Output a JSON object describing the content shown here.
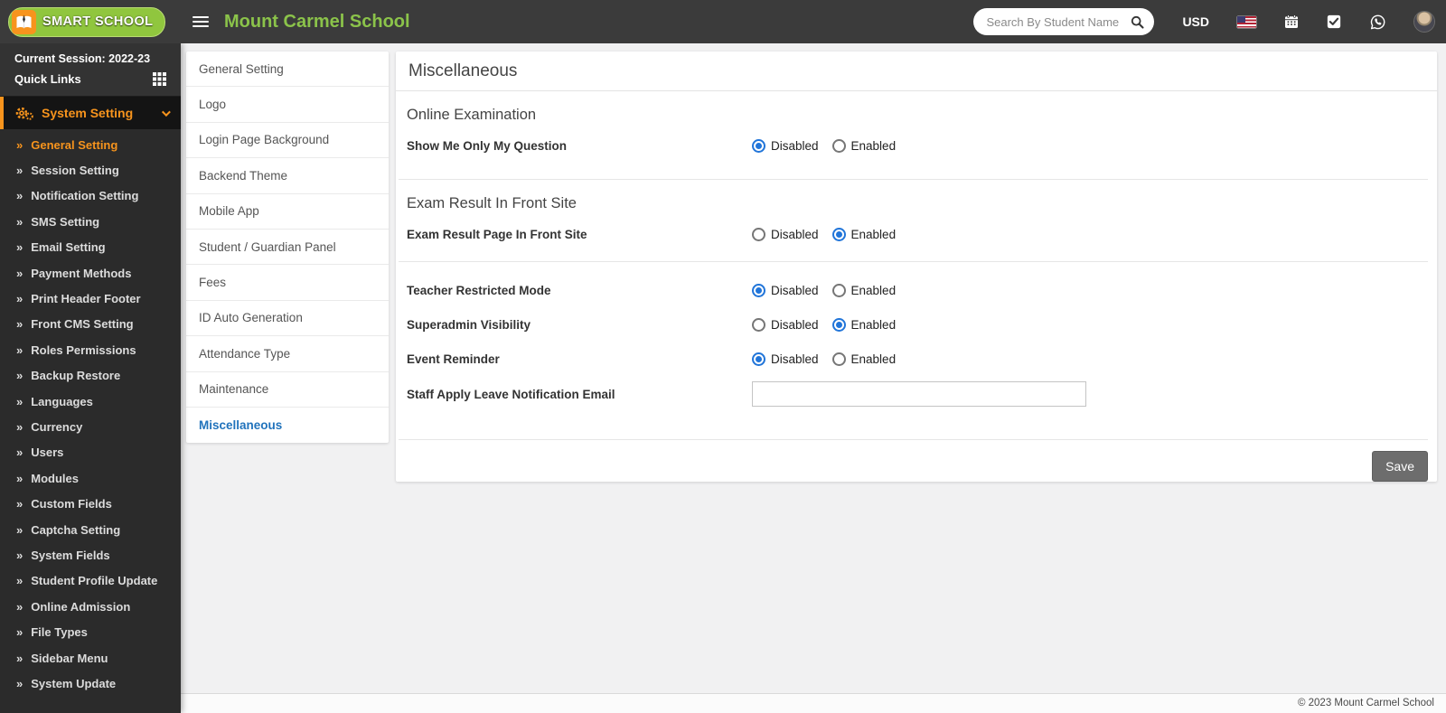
{
  "colors": {
    "accent_orange": "#f7941d",
    "brand_green": "#90c63e",
    "title_green": "#8bc34a",
    "active_link_blue": "#2173bc",
    "radio_blue": "#2175d9",
    "header_bg": "#3b3b3b",
    "sidebar_bg": "#2b2b2b",
    "save_button_gray": "#6d6d6d"
  },
  "icons": {
    "submenu_arrow": "»",
    "names": [
      "book-logo-icon",
      "hamburger-icon",
      "search-icon",
      "us-flag-icon",
      "calendar-icon",
      "tasks-icon",
      "whatsapp-icon",
      "user-avatar",
      "quick-links-grid-icon",
      "gears-icon",
      "chevron-down-icon",
      "submenu-arrow-icon"
    ]
  },
  "header": {
    "logo_text": "SMART SCHOOL",
    "school_name": "Mount Carmel School",
    "search_placeholder": "Search By Student Name",
    "currency_label": "USD"
  },
  "sidebar": {
    "session_label": "Current Session: 2022-23",
    "quick_links_label": "Quick Links",
    "menu": {
      "label": "System Setting",
      "expanded": true
    },
    "items": [
      {
        "label": "General Setting",
        "active": true
      },
      {
        "label": "Session Setting"
      },
      {
        "label": "Notification Setting"
      },
      {
        "label": "SMS Setting"
      },
      {
        "label": "Email Setting"
      },
      {
        "label": "Payment Methods"
      },
      {
        "label": "Print Header Footer"
      },
      {
        "label": "Front CMS Setting"
      },
      {
        "label": "Roles Permissions"
      },
      {
        "label": "Backup Restore"
      },
      {
        "label": "Languages"
      },
      {
        "label": "Currency"
      },
      {
        "label": "Users"
      },
      {
        "label": "Modules"
      },
      {
        "label": "Custom Fields"
      },
      {
        "label": "Captcha Setting"
      },
      {
        "label": "System Fields"
      },
      {
        "label": "Student Profile Update"
      },
      {
        "label": "Online Admission"
      },
      {
        "label": "File Types"
      },
      {
        "label": "Sidebar Menu"
      },
      {
        "label": "System Update"
      }
    ]
  },
  "settings_menu": {
    "items": [
      {
        "label": "General Setting"
      },
      {
        "label": "Logo"
      },
      {
        "label": "Login Page Background"
      },
      {
        "label": "Backend Theme"
      },
      {
        "label": "Mobile App"
      },
      {
        "label": "Student / Guardian Panel"
      },
      {
        "label": "Fees"
      },
      {
        "label": "ID Auto Generation"
      },
      {
        "label": "Attendance Type"
      },
      {
        "label": "Maintenance"
      },
      {
        "label": "Miscellaneous",
        "active": true
      }
    ]
  },
  "main": {
    "title": "Miscellaneous",
    "radio_options": {
      "disabled": "Disabled",
      "enabled": "Enabled"
    },
    "online_exam": {
      "heading": "Online Examination",
      "row": {
        "label": "Show Me Only My Question",
        "selected": "disabled"
      }
    },
    "exam_result": {
      "heading": "Exam Result In Front Site",
      "row": {
        "label": "Exam Result Page In Front Site",
        "selected": "enabled"
      }
    },
    "general_rows": [
      {
        "label": "Teacher Restricted Mode",
        "selected": "disabled"
      },
      {
        "label": "Superadmin Visibility",
        "selected": "enabled"
      },
      {
        "label": "Event Reminder",
        "selected": "disabled"
      }
    ],
    "email_row": {
      "label": "Staff Apply Leave Notification Email",
      "value": ""
    },
    "save_label": "Save"
  },
  "footer": {
    "copyright": "© 2023 Mount Carmel School"
  }
}
